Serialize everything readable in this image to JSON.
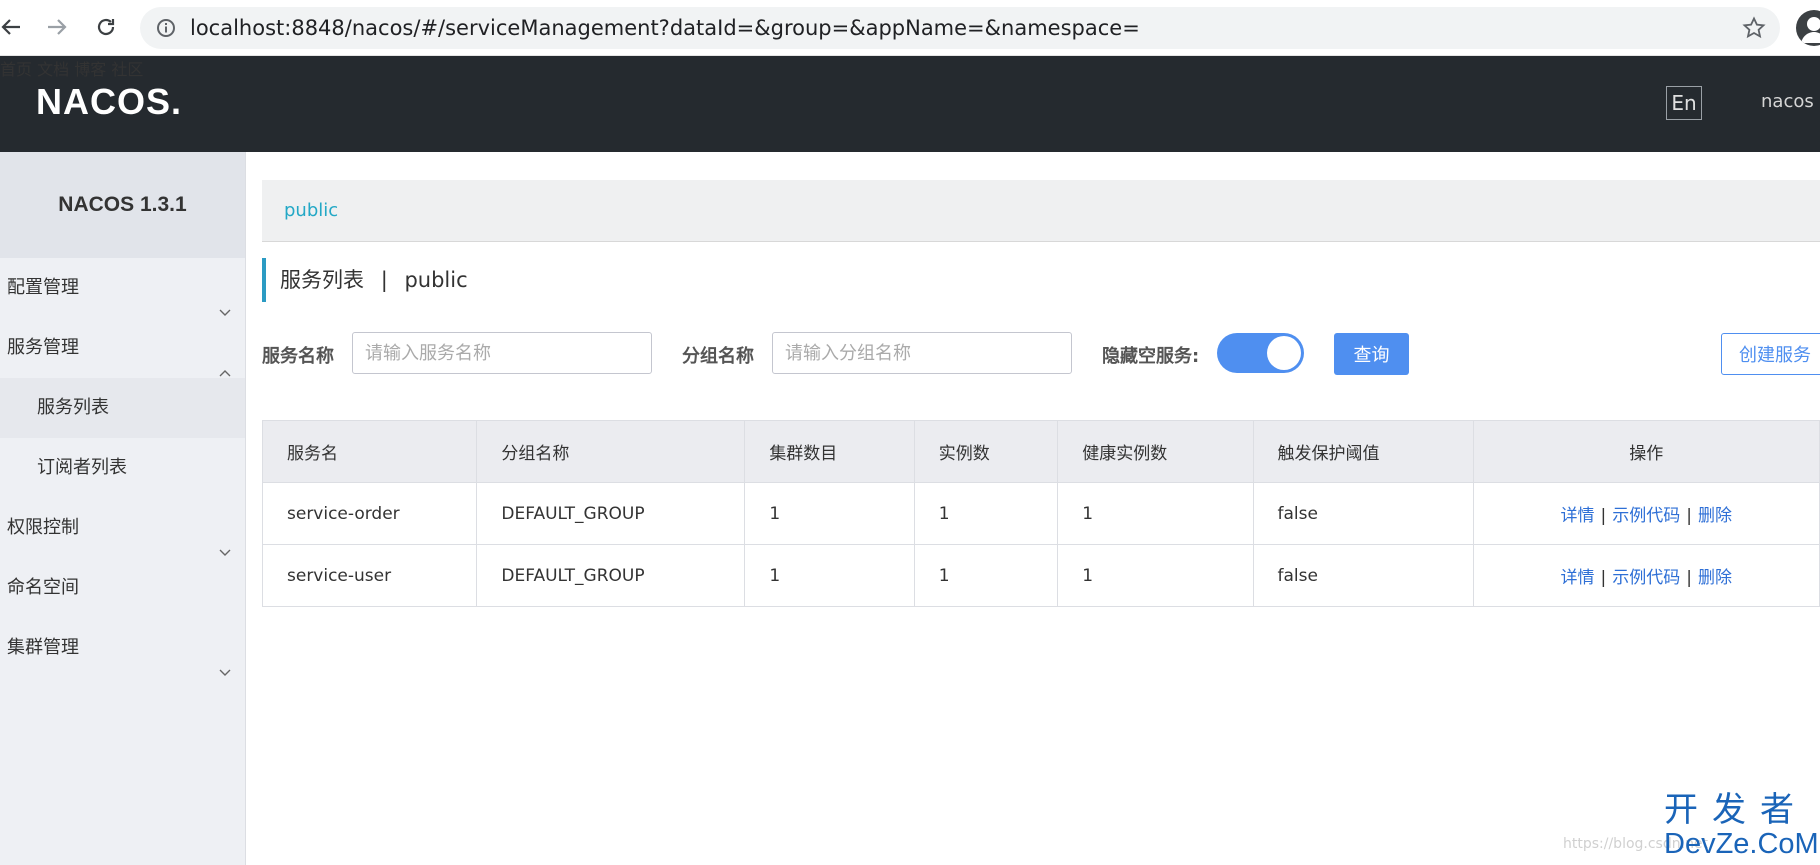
{
  "browser": {
    "url": "localhost:8848/nacos/#/serviceManagement?dataId=&group=&appName=&namespace="
  },
  "header": {
    "logo_text": "NACOS.",
    "nav": [
      "首页",
      "文档",
      "博客",
      "社区"
    ],
    "lang": "En",
    "user": "nacos"
  },
  "sidebar": {
    "brand": "NACOS 1.3.1",
    "items": [
      {
        "label": "配置管理",
        "chevron": "down"
      },
      {
        "label": "服务管理",
        "chevron": "up"
      },
      {
        "label": "服务列表",
        "sub": true,
        "active": true
      },
      {
        "label": "订阅者列表",
        "sub": true
      },
      {
        "label": "权限控制",
        "chevron": "down"
      },
      {
        "label": "命名空间"
      },
      {
        "label": "集群管理",
        "chevron": "down"
      }
    ]
  },
  "namespace_bar": {
    "active": "public"
  },
  "page": {
    "title": "服务列表",
    "separator": "|",
    "namespace": "public"
  },
  "filters": {
    "service_label": "服务名称",
    "service_placeholder": "请输入服务名称",
    "group_label": "分组名称",
    "group_placeholder": "请输入分组名称",
    "hide_empty_label": "隐藏空服务:",
    "hide_empty_on": true,
    "query_button": "查询",
    "create_button": "创建服务"
  },
  "table": {
    "columns": [
      "服务名",
      "分组名称",
      "集群数目",
      "实例数",
      "健康实例数",
      "触发保护阈值",
      "操作"
    ],
    "rows": [
      [
        "service-order",
        "DEFAULT_GROUP",
        "1",
        "1",
        "1",
        "false"
      ],
      [
        "service-user",
        "DEFAULT_GROUP",
        "1",
        "1",
        "1",
        "false"
      ]
    ],
    "actions": [
      "详情",
      "示例代码",
      "删除"
    ],
    "action_separator": "|"
  },
  "watermark": {
    "small": "https://blog.csdn.net",
    "line1": "开发者",
    "line2": "DevZe.CoM"
  },
  "colors": {
    "header_bg": "#252a2f",
    "accent": "#4f8ff0",
    "namespace_link": "#23a8c6",
    "link": "#2e6fd6"
  }
}
